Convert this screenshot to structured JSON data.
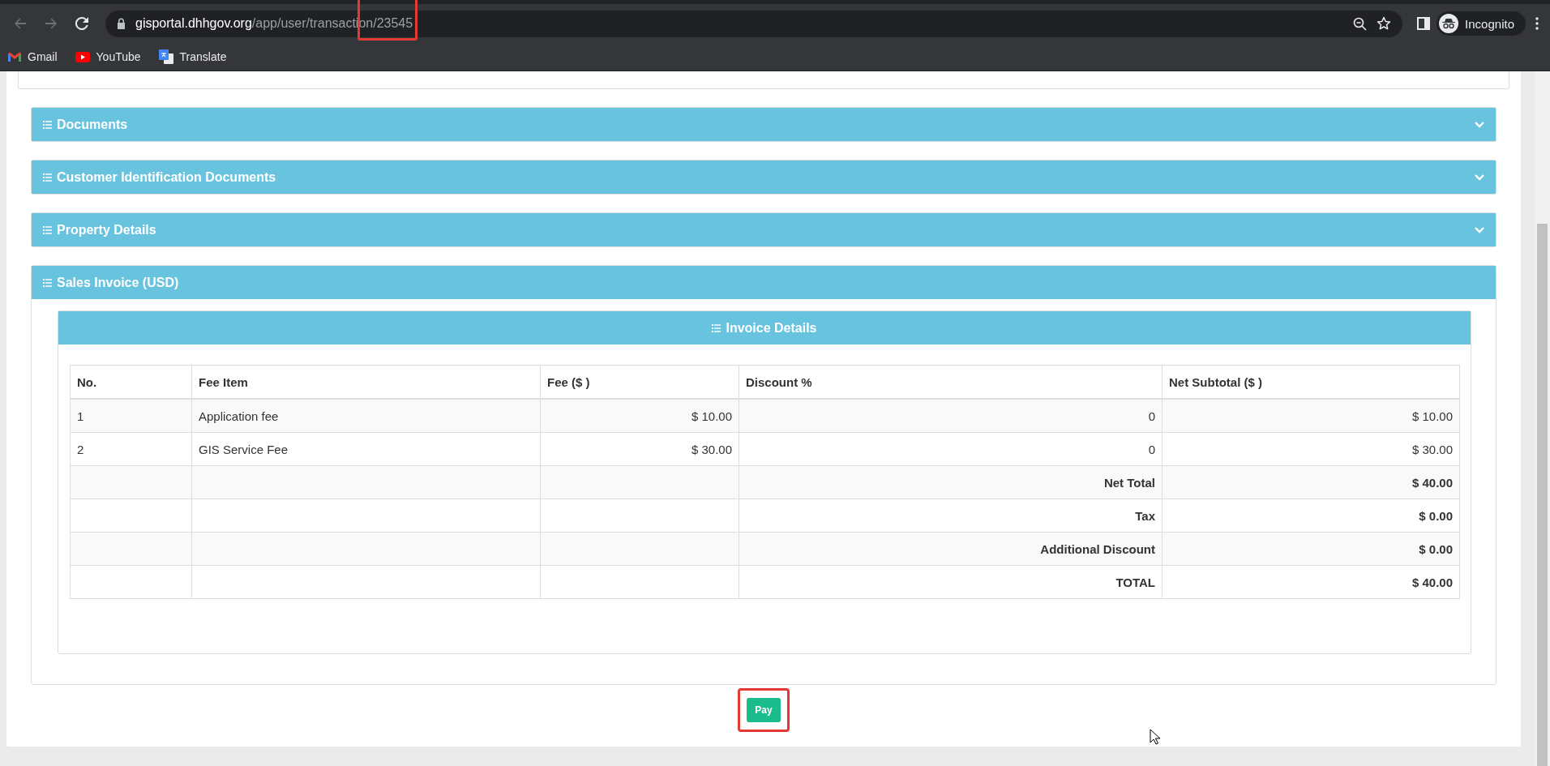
{
  "browser": {
    "back_enabled": false,
    "forward_enabled": false,
    "url": {
      "host": "gisportal.dhhgov.org",
      "path": "/app/user/transacti",
      "path_highlighted": "on/23545",
      "highlighted": true
    },
    "profile": "Incognito",
    "bookmarks": [
      "Gmail",
      "YouTube",
      "Translate"
    ]
  },
  "panels": [
    {
      "title": "Documents",
      "expanded": false
    },
    {
      "title": "Customer Identification Documents",
      "expanded": false
    },
    {
      "title": "Property Details",
      "expanded": false
    },
    {
      "title": "Sales Invoice (USD)",
      "expanded": true
    }
  ],
  "invoice": {
    "title": "Invoice Details",
    "columns": [
      "No.",
      "Fee Item",
      "Fee ($ )",
      "Discount %",
      "Net Subtotal ($ )"
    ],
    "rows": [
      {
        "kind": "item",
        "no": "1",
        "fee_item": "Application fee",
        "fee": "$ 10.00",
        "discount": "0",
        "net_subtotal": "$ 10.00"
      },
      {
        "kind": "item",
        "no": "2",
        "fee_item": "GIS Service Fee",
        "fee": "$ 30.00",
        "discount": "0",
        "net_subtotal": "$ 30.00"
      },
      {
        "kind": "summary",
        "label": "Net Total",
        "value": "$ 40.00"
      },
      {
        "kind": "summary",
        "label": "Tax",
        "value": "$ 0.00"
      },
      {
        "kind": "summary",
        "label": "Additional Discount",
        "value": "$ 0.00"
      },
      {
        "kind": "summary",
        "label": "TOTAL",
        "value": "$ 40.00"
      }
    ]
  },
  "pay_button": {
    "label": "Pay",
    "highlighted": true
  }
}
